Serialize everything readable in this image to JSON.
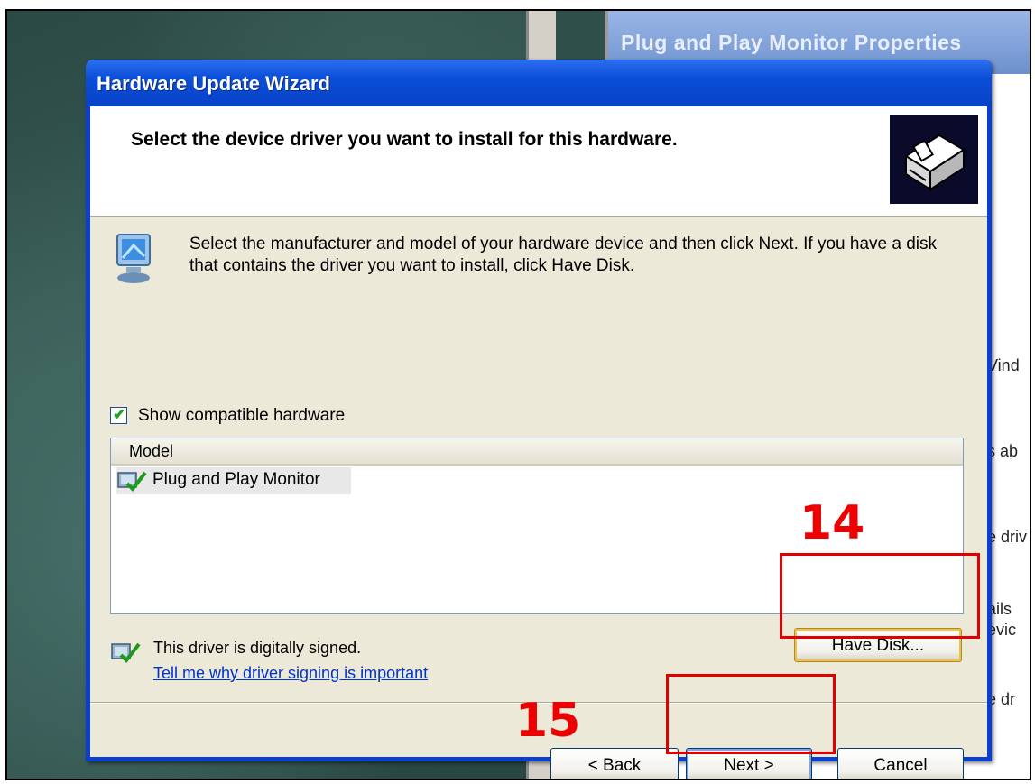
{
  "background_window": {
    "title": "Plug and Play Monitor Properties",
    "fragments": [
      "Vind",
      "s ab",
      "e driv",
      "ails",
      "evic",
      "e dr"
    ]
  },
  "dialog": {
    "title": "Hardware Update Wizard",
    "header_title": "Select the device driver you want to install for this hardware.",
    "instruction": "Select the manufacturer and model of your hardware device and then click Next. If you have a disk that contains the driver you want to install, click Have Disk.",
    "show_compatible_label": "Show compatible hardware",
    "show_compatible_checked": true,
    "list": {
      "column_header": "Model",
      "items": [
        {
          "label": "Plug and Play Monitor",
          "selected": true
        }
      ]
    },
    "signed_text": "This driver is digitally signed.",
    "signed_link": "Tell me why driver signing is important",
    "buttons": {
      "have_disk": "Have Disk...",
      "back": "< Back",
      "next": "Next >",
      "cancel": "Cancel"
    }
  },
  "annotations": {
    "step_14": "14",
    "step_15": "15",
    "color": "#e00000"
  }
}
